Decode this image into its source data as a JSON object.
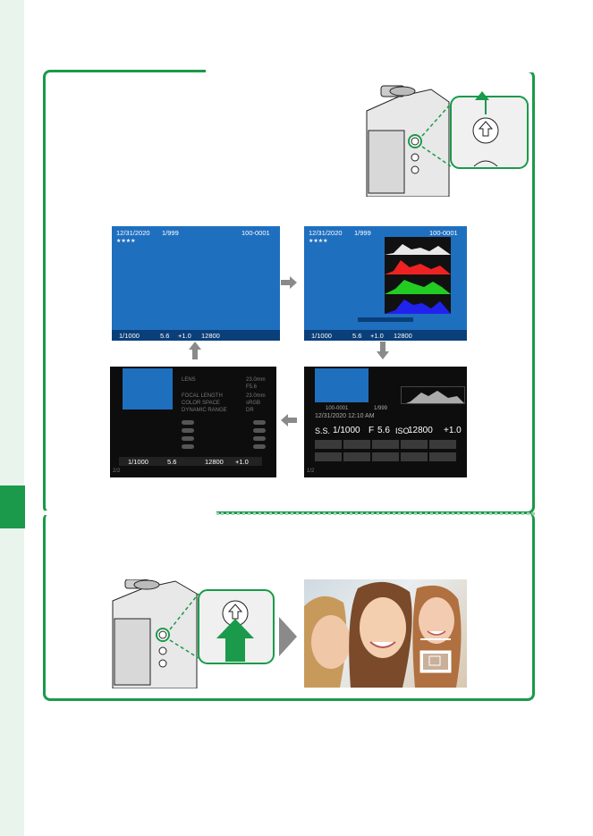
{
  "screen1": {
    "date": "12/31/2020",
    "frame": "1/999",
    "file_no": "100-0001",
    "stars": "★★★★",
    "shutter": "1/1000",
    "aperture": "5.6",
    "exposure_comp": "+1.0",
    "iso": "12800"
  },
  "screen2": {
    "date": "12/31/2020",
    "frame": "1/999",
    "file_no": "100-0001",
    "stars": "★★★★",
    "shutter": "1/1000",
    "aperture": "5.6",
    "exposure_comp": "+1.0",
    "iso": "12800"
  },
  "screen3": {
    "file_no": "100-0001",
    "frame": "1/999",
    "datetime": "12/31/2020 12:10 AM",
    "ss_label": "S.S.",
    "shutter": "1/1000",
    "f_label": "F",
    "aperture": "5.6",
    "iso_label": "ISO",
    "iso": "12800",
    "exposure_comp": "+1.0",
    "page": "1/2"
  },
  "screen4": {
    "lens": "LENS",
    "lens_val": "23.0mm",
    "lens_val2": "F5.6",
    "focal_length": "FOCAL LENGTH",
    "focal_val": "23.0mm",
    "color_space": "COLOR SPACE",
    "color_val": "sRGB",
    "dynamic_range": "DYNAMIC RANGE",
    "dr_val": "DR",
    "shutter": "1/1000",
    "aperture": "5.6",
    "iso": "12800",
    "exposure_comp": "+1.0",
    "page": "2/2"
  },
  "colors": {
    "accent": "#1a9a4a",
    "screen_blue": "#1f6fbf",
    "arrow_gray": "#8a8a8a"
  }
}
